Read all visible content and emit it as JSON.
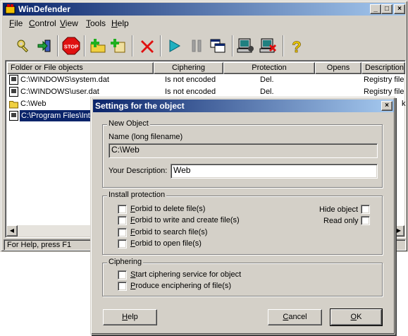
{
  "app": {
    "title": "WinDefender",
    "title_buttons": [
      "_",
      "□",
      "×"
    ]
  },
  "menu": [
    {
      "key": "F",
      "rest": "ile"
    },
    {
      "key": "C",
      "rest": "ontrol"
    },
    {
      "key": "V",
      "rest": "iew"
    },
    {
      "key": "T",
      "rest": "ools"
    },
    {
      "key": "H",
      "rest": "elp"
    }
  ],
  "toolbar": {
    "stop_label": "STOP",
    "help_glyph": "?",
    "icons": [
      "keys-icon",
      "login-icon",
      "stop-icon",
      "add-folder-icon",
      "add-file-icon",
      "delete-icon",
      "play-icon",
      "pause-icon",
      "windows-icon",
      "computer-settings-icon",
      "computer-delete-icon",
      "help-icon"
    ]
  },
  "list": {
    "columns": [
      "Folder or File objects",
      "Ciphering",
      "Protection",
      "Opens",
      "Description"
    ],
    "rows": [
      {
        "object": "C:\\WINDOWS\\system.dat",
        "ciphering": "Is not encoded",
        "protection": "Del.",
        "opens": "",
        "description": "Registry file",
        "icon": "file-icon"
      },
      {
        "object": "C:\\WINDOWS\\user.dat",
        "ciphering": "Is not encoded",
        "protection": "Del.",
        "opens": "",
        "description": "Registry file",
        "icon": "file-icon"
      },
      {
        "object": "C:\\Web",
        "ciphering": "",
        "protection": "",
        "opens": "",
        "description": "k",
        "icon": "folder-icon"
      },
      {
        "object": "C:\\Program Files\\Inte",
        "ciphering": "",
        "protection": "",
        "opens": "",
        "description": "",
        "icon": "file-icon"
      }
    ]
  },
  "statusbar": {
    "help_text": "For Help, press F1"
  },
  "dialog": {
    "title": "Settings for the object",
    "new_object": {
      "group_title": "New Object",
      "name_label": "Name (long filename)",
      "name_value": "C:\\Web",
      "description_label": "Your Description:",
      "description_value": "Web"
    },
    "install_protection": {
      "group_title": "Install protection",
      "options": [
        {
          "key": "F",
          "rest": "orbid to delete file(s)",
          "checked": false
        },
        {
          "key": "F",
          "rest": "orbid to write and create file(s)",
          "checked": false
        },
        {
          "key": "F",
          "rest": "orbid to search file(s)",
          "checked": false
        },
        {
          "key": "F",
          "rest": "orbid to open file(s)",
          "checked": false
        }
      ],
      "hide_object_label": "Hide object",
      "read_only_label": "Read only"
    },
    "ciphering": {
      "group_title": "Ciphering",
      "options": [
        {
          "key": "S",
          "rest": "tart ciphering service for object",
          "checked": false
        },
        {
          "key": "P",
          "rest": "roduce enciphering of file(s)",
          "checked": false
        }
      ]
    },
    "buttons": {
      "help": {
        "key": "H",
        "rest": "elp"
      },
      "cancel": {
        "key": "C",
        "rest": "ancel"
      },
      "ok": {
        "key": "O",
        "rest": "K"
      }
    }
  }
}
